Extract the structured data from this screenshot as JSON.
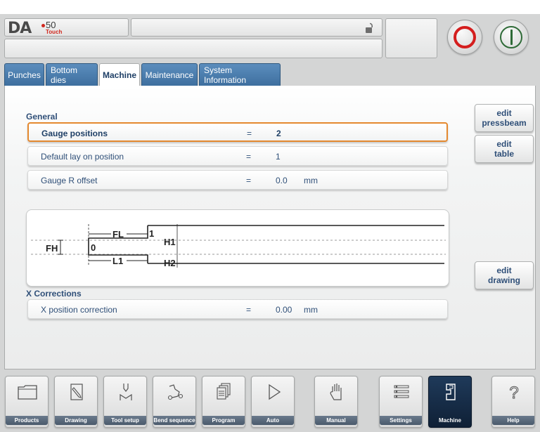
{
  "header": {
    "logo_text": "DA",
    "logo_model": "50",
    "logo_sub": "Touch",
    "title": "",
    "status": ""
  },
  "tabs": [
    {
      "label": "Punches",
      "active": false
    },
    {
      "label": "Bottom dies",
      "active": false
    },
    {
      "label": "Machine",
      "active": true
    },
    {
      "label": "Maintenance",
      "active": false
    },
    {
      "label": "System Information",
      "active": false
    }
  ],
  "general": {
    "title": "General",
    "rows": [
      {
        "label": "Gauge positions",
        "eq": "=",
        "value": "2",
        "unit": ""
      },
      {
        "label": "Default lay on position",
        "eq": "=",
        "value": "1",
        "unit": ""
      },
      {
        "label": "Gauge R offset",
        "eq": "=",
        "value": "0.0",
        "unit": "mm"
      }
    ]
  },
  "drawing": {
    "labels": {
      "fl": "FL",
      "fh": "FH",
      "zero": "0",
      "one": "1",
      "h1": "H1",
      "l1": "L1",
      "h2": "H2"
    }
  },
  "x_corrections": {
    "title": "X Corrections",
    "rows": [
      {
        "label": "X position correction",
        "eq": "=",
        "value": "0.00",
        "unit": "mm"
      }
    ]
  },
  "side_buttons": {
    "edit_pressbeam": {
      "line1": "edit",
      "line2": "pressbeam"
    },
    "edit_table": {
      "line1": "edit",
      "line2": "table"
    },
    "edit_drawing": {
      "line1": "edit",
      "line2": "drawing"
    }
  },
  "nav": [
    {
      "label": "Products",
      "icon": "folder-icon"
    },
    {
      "label": "Drawing",
      "icon": "pencil-icon"
    },
    {
      "label": "Tool setup",
      "icon": "tool-icon"
    },
    {
      "label": "Bend sequence",
      "icon": "bend-icon"
    },
    {
      "label": "Program",
      "icon": "program-icon"
    },
    {
      "label": "Auto",
      "icon": "play-icon"
    },
    {
      "label": "Manual",
      "icon": "hand-icon"
    },
    {
      "label": "Settings",
      "icon": "settings-icon"
    },
    {
      "label": "Machine",
      "icon": "machine-icon",
      "active": true
    },
    {
      "label": "Help",
      "icon": "help-icon"
    }
  ],
  "colors": {
    "accent_blue": "#3e6f9f",
    "selection_orange": "#e4892f",
    "stop_red": "#d41e1e",
    "start_green": "#2f6b38"
  }
}
